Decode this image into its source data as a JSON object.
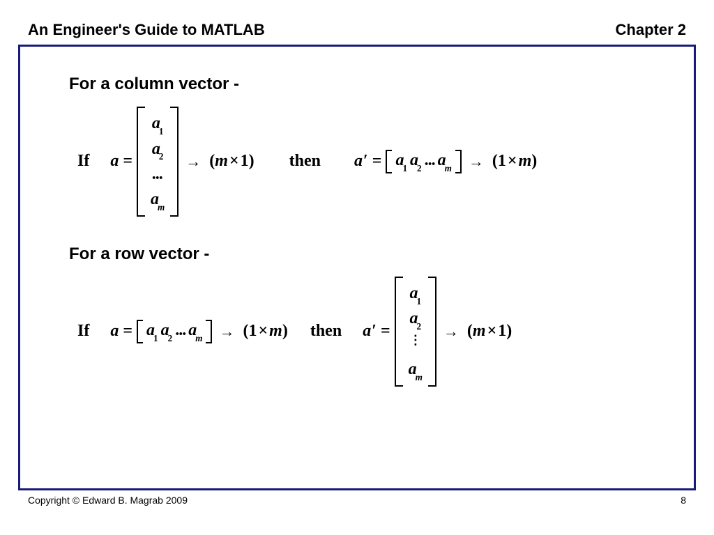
{
  "header": {
    "title": "An Engineer's Guide to MATLAB",
    "chapter": "Chapter 2"
  },
  "section1": {
    "heading": "For a column vector -",
    "if": "If",
    "lhs": "a",
    "col": {
      "r1": "a",
      "s1": "1",
      "r2": "a",
      "s2": "2",
      "r3": "...",
      "r4": "a",
      "s4": "m"
    },
    "dim1": "(m × 1)",
    "then": "then",
    "rhs": "a",
    "prime": "′",
    "row": {
      "e1": "a",
      "s1": "1",
      "e2": "a",
      "s2": "2",
      "dots": "...",
      "e3": "a",
      "s3": "m"
    },
    "dim2": "(1 × m)"
  },
  "section2": {
    "heading": "For a row vector -",
    "if": "If",
    "lhs": "a",
    "row": {
      "e1": "a",
      "s1": "1",
      "e2": "a",
      "s2": "2",
      "dots": "...",
      "e3": "a",
      "s3": "m"
    },
    "dim1": "(1 × m)",
    "then": "then",
    "rhs": "a",
    "prime": "′",
    "col": {
      "r1": "a",
      "s1": "1",
      "r2": "a",
      "s2": "2",
      "r4": "a",
      "s4": "m"
    },
    "dim2": "(m × 1)"
  },
  "footer": {
    "copyright": "Copyright © Edward B. Magrab 2009",
    "page": "8"
  },
  "glyph": {
    "eq": "=",
    "arrow": "→"
  }
}
